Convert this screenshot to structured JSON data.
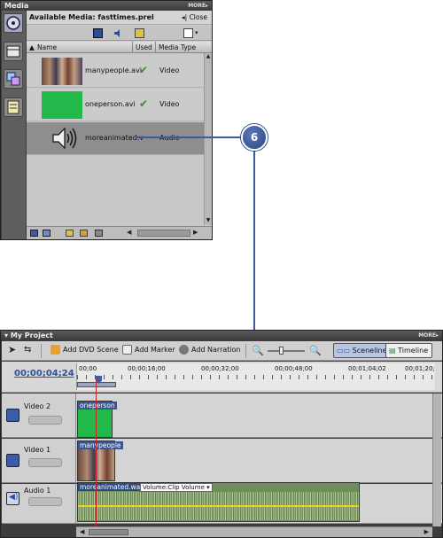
{
  "media_panel": {
    "title": "Media",
    "more_label": "MORE▸",
    "available_label": "Available Media: fasttimes.prel",
    "close_label": "Close",
    "close_glyph": "◂|",
    "columns": {
      "name": "Name",
      "used": "Used",
      "media_type": "Media Type"
    },
    "items": [
      {
        "name": "manypeople.avi",
        "used": "✔",
        "type": "Video"
      },
      {
        "name": "oneperson.avi",
        "used": "✔",
        "type": "Video"
      },
      {
        "name": "moreanimated.v",
        "used": "",
        "type": "Audio"
      }
    ]
  },
  "callout": {
    "number": "6"
  },
  "project_panel": {
    "title": "My Project",
    "more_label": "MORE▸",
    "toolbar": {
      "add_dvd_scene": "Add DVD Scene",
      "add_marker": "Add Marker",
      "add_narration": "Add Narration",
      "sceneline": "Sceneline",
      "timeline": "Timeline"
    },
    "timecode": "00;00;04;24",
    "ruler_ticks": [
      "00;00",
      "00;00;16;00",
      "00;00;32;00",
      "00;00;48;00",
      "00;01;04;02",
      "00;01;20;"
    ],
    "tracks": [
      {
        "name": "Video 2",
        "clip_label": "oneperson"
      },
      {
        "name": "Video 1",
        "clip_label": "manypeople"
      },
      {
        "name": "Audio 1",
        "clip_label": "moreanimated.wav",
        "clip_volume": "Volume:Clip Volume ▾"
      }
    ]
  },
  "colors": {
    "accent": "#2b50a0",
    "callout": "#2a4785",
    "check": "#3a8b2a",
    "green_screen": "#23b84a",
    "audio_wave": "#6e8d5a",
    "volume_line": "#f0d020",
    "playhead": "#cc2222"
  }
}
